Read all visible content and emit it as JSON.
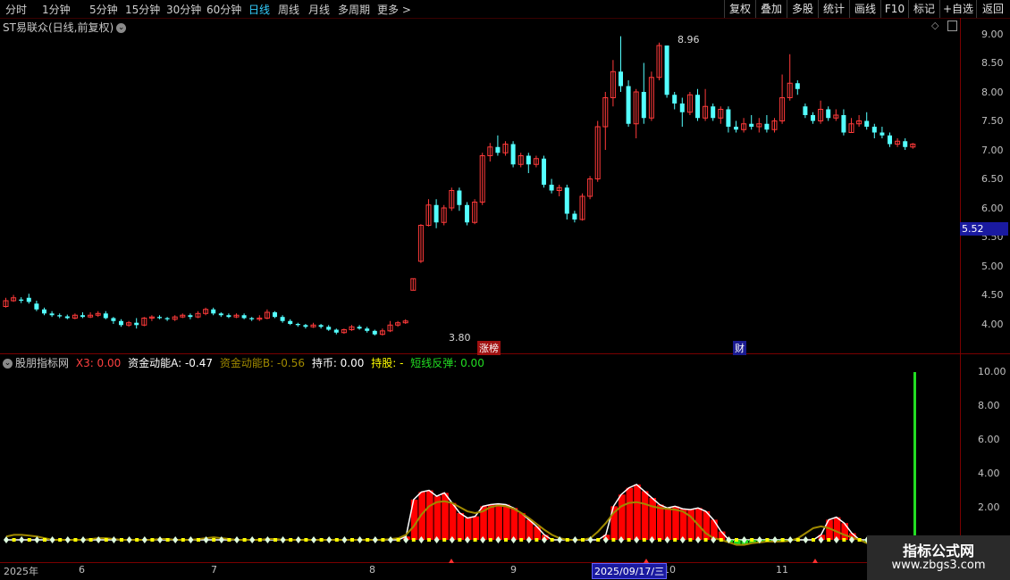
{
  "toolbar": {
    "periods": [
      "分时",
      "1分钟",
      "5分钟",
      "15分钟",
      "30分钟",
      "60分钟",
      "日线",
      "周线",
      "月线",
      "多周期",
      "更多 >"
    ],
    "active_period": "日线",
    "right_buttons": [
      "复权",
      "叠加",
      "多股",
      "统计",
      "画线",
      "F10",
      "标记",
      "+自选",
      "返回"
    ]
  },
  "main_panel": {
    "title": "ST易联众(日线,前复权)",
    "current_price_tag": "5.52",
    "high_annotation": "8.96",
    "low_annotation": "3.80",
    "marker_zhangbang": "涨榜",
    "marker_cai": "财",
    "y_axis_labels": [
      "9.00",
      "8.50",
      "8.00",
      "7.50",
      "7.00",
      "6.50",
      "6.00",
      "5.50",
      "5.00",
      "4.50",
      "4.00"
    ]
  },
  "indicator_panel": {
    "name": "股朋指标网",
    "x3": "X3: 0.00",
    "fund_a": "资金动能A: -0.47",
    "fund_b": "资金动能B: -0.56",
    "hold_coin": "持币: 0.00",
    "hold_stock": "持股: -",
    "short_rebound": "短线反弹: 0.00",
    "y_axis_labels": [
      "10.00",
      "8.00",
      "6.00",
      "4.00",
      "2.00"
    ]
  },
  "x_axis": {
    "labels": [
      "2025年",
      "6",
      "7",
      "8",
      "9",
      "10",
      "11"
    ],
    "cursor_date": "2025/09/17/三"
  },
  "watermark": {
    "line1": "指标公式网",
    "line2": "www.zbgs3.com"
  },
  "colors": {
    "up": "#ff3a3a",
    "down": "#54ffff",
    "indicator_fill": "#ff0000",
    "indicator_line": "#a08a00",
    "signal_bar": "#22dd22"
  },
  "chart_data": {
    "type": "candlestick",
    "ylim": [
      3.8,
      9.1
    ],
    "candles": [
      [
        4.3,
        4.4,
        4.45,
        4.28
      ],
      [
        4.4,
        4.45,
        4.5,
        4.38
      ],
      [
        4.42,
        4.4,
        4.46,
        4.36
      ],
      [
        4.45,
        4.38,
        4.52,
        4.35
      ],
      [
        4.35,
        4.25,
        4.4,
        4.22
      ],
      [
        4.25,
        4.18,
        4.28,
        4.15
      ],
      [
        4.18,
        4.15,
        4.22,
        4.12
      ],
      [
        4.15,
        4.13,
        4.18,
        4.1
      ],
      [
        4.13,
        4.1,
        4.16,
        4.08
      ],
      [
        4.1,
        4.15,
        4.18,
        4.08
      ],
      [
        4.15,
        4.12,
        4.2,
        4.1
      ],
      [
        4.12,
        4.15,
        4.2,
        4.1
      ],
      [
        4.15,
        4.18,
        4.22,
        4.12
      ],
      [
        4.18,
        4.1,
        4.22,
        4.08
      ],
      [
        4.1,
        4.05,
        4.12,
        4.0
      ],
      [
        4.05,
        3.98,
        4.08,
        3.95
      ],
      [
        3.98,
        4.02,
        4.05,
        3.95
      ],
      [
        4.02,
        3.98,
        4.1,
        3.92
      ],
      [
        3.98,
        4.1,
        4.12,
        3.96
      ],
      [
        4.1,
        4.12,
        4.15,
        4.05
      ],
      [
        4.12,
        4.1,
        4.15,
        4.08
      ],
      [
        4.1,
        4.08,
        4.12,
        4.05
      ],
      [
        4.08,
        4.12,
        4.15,
        4.05
      ],
      [
        4.12,
        4.15,
        4.18,
        4.1
      ],
      [
        4.15,
        4.12,
        4.18,
        4.08
      ],
      [
        4.12,
        4.18,
        4.22,
        4.1
      ],
      [
        4.18,
        4.25,
        4.28,
        4.15
      ],
      [
        4.25,
        4.18,
        4.28,
        4.15
      ],
      [
        4.18,
        4.15,
        4.2,
        4.12
      ],
      [
        4.15,
        4.12,
        4.18,
        4.1
      ],
      [
        4.12,
        4.15,
        4.18,
        4.1
      ],
      [
        4.15,
        4.1,
        4.18,
        4.08
      ],
      [
        4.1,
        4.08,
        4.12,
        4.05
      ],
      [
        4.08,
        4.1,
        4.15,
        4.05
      ],
      [
        4.1,
        4.2,
        4.25,
        4.08
      ],
      [
        4.2,
        4.12,
        4.22,
        4.1
      ],
      [
        4.12,
        4.05,
        4.15,
        4.02
      ],
      [
        4.05,
        4.0,
        4.08,
        3.98
      ],
      [
        4.0,
        3.98,
        4.02,
        3.95
      ],
      [
        3.98,
        3.95,
        4.0,
        3.92
      ],
      [
        3.95,
        3.98,
        4.02,
        3.93
      ],
      [
        3.98,
        3.95,
        4.0,
        3.92
      ],
      [
        3.95,
        3.9,
        3.98,
        3.88
      ],
      [
        3.9,
        3.85,
        3.92,
        3.82
      ],
      [
        3.85,
        3.9,
        3.92,
        3.83
      ],
      [
        3.9,
        3.95,
        3.98,
        3.88
      ],
      [
        3.95,
        3.92,
        3.98,
        3.9
      ],
      [
        3.92,
        3.88,
        3.95,
        3.85
      ],
      [
        3.88,
        3.82,
        3.9,
        3.8
      ],
      [
        3.82,
        3.88,
        3.92,
        3.8
      ],
      [
        3.88,
        3.98,
        4.05,
        3.86
      ],
      [
        3.98,
        4.02,
        4.05,
        3.95
      ],
      [
        4.02,
        4.05,
        4.08,
        4.0
      ],
      [
        4.58,
        4.78,
        4.78,
        4.58
      ],
      [
        5.08,
        5.7,
        5.72,
        5.05
      ],
      [
        5.7,
        6.05,
        6.15,
        5.68
      ],
      [
        6.05,
        5.75,
        6.15,
        5.65
      ],
      [
        5.75,
        6.0,
        6.05,
        5.7
      ],
      [
        6.0,
        6.3,
        6.35,
        5.95
      ],
      [
        6.3,
        6.05,
        6.35,
        5.95
      ],
      [
        6.05,
        5.75,
        6.1,
        5.7
      ],
      [
        5.75,
        6.1,
        6.15,
        5.72
      ],
      [
        6.1,
        6.9,
        6.95,
        6.05
      ],
      [
        6.9,
        7.05,
        7.12,
        6.8
      ],
      [
        7.05,
        6.95,
        7.25,
        6.9
      ],
      [
        6.95,
        7.1,
        7.15,
        6.9
      ],
      [
        7.1,
        6.75,
        7.15,
        6.7
      ],
      [
        6.75,
        6.9,
        6.95,
        6.7
      ],
      [
        6.9,
        6.75,
        6.95,
        6.6
      ],
      [
        6.75,
        6.85,
        6.9,
        6.7
      ],
      [
        6.85,
        6.4,
        6.9,
        6.35
      ],
      [
        6.4,
        6.3,
        6.5,
        6.25
      ],
      [
        6.3,
        6.35,
        6.4,
        6.2
      ],
      [
        6.35,
        5.9,
        6.4,
        5.8
      ],
      [
        5.9,
        5.8,
        5.95,
        5.75
      ],
      [
        5.8,
        6.2,
        6.25,
        5.78
      ],
      [
        6.2,
        6.5,
        6.55,
        6.15
      ],
      [
        6.5,
        7.4,
        7.5,
        6.45
      ],
      [
        7.4,
        7.9,
        8.0,
        7.0
      ],
      [
        7.9,
        8.35,
        8.55,
        7.75
      ],
      [
        8.35,
        8.1,
        8.96,
        8.0
      ],
      [
        8.1,
        7.45,
        8.2,
        7.4
      ],
      [
        7.45,
        8.0,
        8.05,
        7.2
      ],
      [
        8.0,
        7.55,
        8.5,
        7.45
      ],
      [
        7.55,
        8.25,
        8.35,
        7.5
      ],
      [
        8.25,
        8.8,
        8.85,
        8.2
      ],
      [
        8.8,
        7.95,
        8.8,
        7.9
      ],
      [
        7.95,
        7.8,
        8.0,
        7.7
      ],
      [
        7.8,
        7.65,
        7.9,
        7.4
      ],
      [
        7.65,
        7.95,
        8.0,
        7.6
      ],
      [
        7.95,
        7.55,
        8.05,
        7.5
      ],
      [
        7.55,
        7.75,
        8.05,
        7.5
      ],
      [
        7.75,
        7.55,
        7.8,
        7.5
      ],
      [
        7.55,
        7.7,
        7.75,
        7.45
      ],
      [
        7.7,
        7.4,
        7.75,
        7.3
      ],
      [
        7.4,
        7.35,
        7.5,
        7.3
      ],
      [
        7.35,
        7.45,
        7.55,
        7.3
      ],
      [
        7.45,
        7.4,
        7.6,
        7.35
      ],
      [
        7.4,
        7.45,
        7.55,
        7.3
      ],
      [
        7.45,
        7.35,
        7.6,
        7.3
      ],
      [
        7.35,
        7.5,
        7.55,
        7.3
      ],
      [
        7.5,
        7.9,
        8.3,
        7.45
      ],
      [
        7.9,
        8.15,
        8.65,
        7.85
      ],
      [
        8.15,
        8.05,
        8.2,
        7.95
      ],
      [
        7.75,
        7.6,
        7.8,
        7.55
      ],
      [
        7.6,
        7.5,
        7.65,
        7.45
      ],
      [
        7.5,
        7.7,
        7.85,
        7.45
      ],
      [
        7.7,
        7.55,
        7.75,
        7.5
      ],
      [
        7.55,
        7.6,
        7.7,
        7.5
      ],
      [
        7.6,
        7.3,
        7.7,
        7.25
      ],
      [
        7.3,
        7.45,
        7.55,
        7.3
      ],
      [
        7.45,
        7.5,
        7.6,
        7.4
      ],
      [
        7.5,
        7.4,
        7.65,
        7.35
      ],
      [
        7.4,
        7.3,
        7.45,
        7.2
      ],
      [
        7.3,
        7.25,
        7.4,
        7.2
      ],
      [
        7.25,
        7.1,
        7.3,
        7.05
      ],
      [
        7.1,
        7.15,
        7.2,
        7.05
      ],
      [
        7.15,
        7.05,
        7.2,
        7.0
      ],
      [
        7.05,
        7.1,
        7.12,
        7.02
      ]
    ],
    "series": [
      {
        "values": [
          0,
          0,
          0,
          0,
          0,
          0,
          0,
          0,
          0,
          0,
          0,
          0,
          0,
          0,
          0,
          0,
          0,
          0,
          0,
          0,
          0,
          0,
          0,
          0,
          0,
          0,
          0,
          0,
          0,
          0,
          0,
          0,
          0,
          0,
          0,
          0,
          0,
          0,
          0,
          0,
          0,
          0,
          0,
          0,
          0,
          0,
          0,
          0,
          0,
          0,
          0,
          0,
          0.2,
          2.4,
          2.85,
          2.95,
          2.6,
          2.8,
          2.2,
          1.6,
          1.3,
          1.4,
          2.0,
          2.1,
          2.15,
          2.1,
          1.9,
          1.6,
          1.2,
          0.8,
          0.3,
          0,
          0,
          0,
          0,
          0,
          0,
          0,
          0.3,
          2.0,
          2.7,
          3.1,
          3.3,
          2.9,
          2.5,
          2.1,
          1.9,
          2.0,
          1.85,
          1.8,
          1.9,
          1.7,
          1.2,
          0.5,
          0,
          0,
          0,
          0,
          0,
          0,
          0,
          0,
          0,
          0,
          0,
          0,
          0.3,
          1.2,
          1.35,
          1.0,
          0.4,
          0,
          0,
          0,
          0,
          0,
          0,
          0,
          0,
          0,
          0,
          0,
          0,
          0
        ]
      },
      {
        "values": [
          0.2,
          0.3,
          0.3,
          0.25,
          0.2,
          0.1,
          0,
          0,
          0,
          0,
          0,
          0.05,
          0.1,
          0.1,
          0.05,
          0,
          0,
          0,
          0,
          0,
          0.05,
          0.05,
          0,
          0,
          0,
          0.05,
          0.1,
          0.15,
          0.1,
          0.05,
          0,
          0,
          0,
          0,
          0.05,
          0.05,
          0,
          0,
          0,
          0,
          0,
          0,
          0,
          0,
          0,
          0,
          0,
          0,
          0,
          0,
          0.05,
          0.1,
          0.3,
          0.8,
          1.5,
          2.0,
          2.25,
          2.3,
          2.2,
          1.95,
          1.7,
          1.6,
          1.7,
          1.95,
          2.05,
          2.0,
          1.85,
          1.6,
          1.3,
          0.95,
          0.6,
          0.3,
          0.1,
          0,
          0,
          0,
          0.1,
          0.5,
          1.0,
          1.6,
          2.0,
          2.2,
          2.25,
          2.15,
          2.0,
          1.9,
          1.85,
          1.8,
          1.7,
          1.4,
          0.9,
          0.4,
          0.1,
          0,
          -0.15,
          -0.3,
          -0.3,
          -0.2,
          -0.15,
          -0.1,
          -0.1,
          -0.1,
          -0.05,
          0.1,
          0.4,
          0.7,
          0.8,
          0.7,
          0.5,
          0.3,
          0.15,
          0,
          -0.2,
          -0.35,
          -0.4,
          -0.45,
          -0.47,
          -0.47,
          -0.47,
          -0.47
        ]
      }
    ]
  }
}
